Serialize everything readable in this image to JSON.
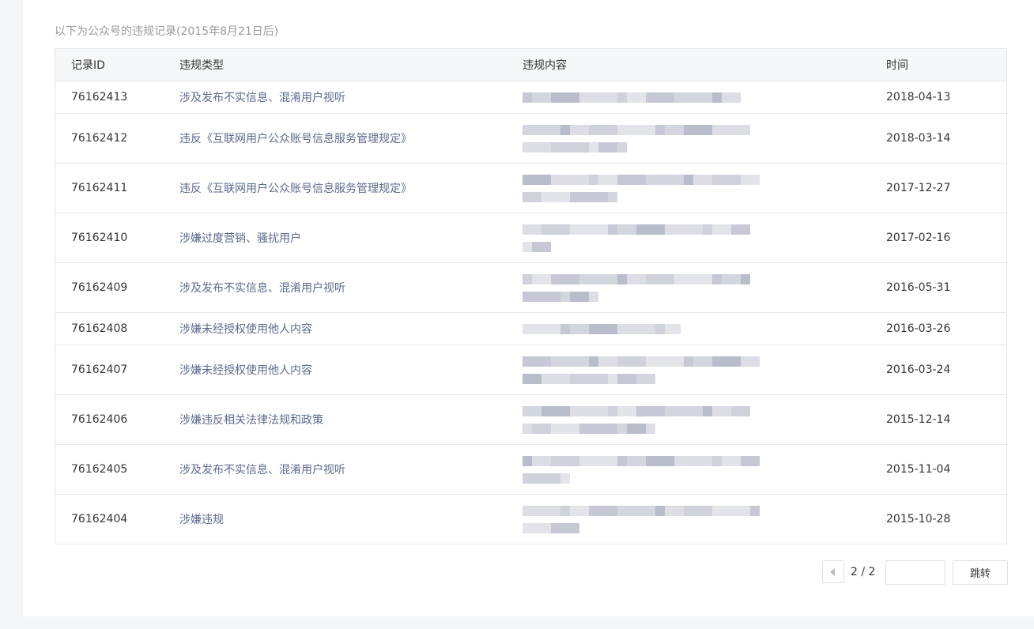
{
  "notice": "以下为公众号的违规记录(2015年8月21日后)",
  "table": {
    "headers": {
      "id": "记录ID",
      "type": "违规类型",
      "content": "违规内容",
      "time": "时间"
    },
    "rows": [
      {
        "id": "76162413",
        "type": "涉及发布不实信息、混淆用户视听",
        "time": "2018-04-13"
      },
      {
        "id": "76162412",
        "type": "违反《互联网用户公众账号信息服务管理规定》",
        "time": "2018-03-14"
      },
      {
        "id": "76162411",
        "type": "违反《互联网用户公众账号信息服务管理规定》",
        "time": "2017-12-27"
      },
      {
        "id": "76162410",
        "type": "涉嫌过度营销、骚扰用户",
        "time": "2017-02-16"
      },
      {
        "id": "76162409",
        "type": "涉及发布不实信息、混淆用户视听",
        "time": "2016-05-31"
      },
      {
        "id": "76162408",
        "type": "涉嫌未经授权使用他人内容",
        "time": "2016-03-26"
      },
      {
        "id": "76162407",
        "type": "涉嫌未经授权使用他人内容",
        "time": "2016-03-24"
      },
      {
        "id": "76162406",
        "type": "涉嫌违反相关法律法规和政策",
        "time": "2015-12-14"
      },
      {
        "id": "76162405",
        "type": "涉及发布不实信息、混淆用户视听",
        "time": "2015-11-04"
      },
      {
        "id": "76162404",
        "type": "涉嫌违规",
        "time": "2015-10-28"
      }
    ]
  },
  "pagination": {
    "prev_icon": "caret-left-icon",
    "page_text": "2 / 2",
    "input_value": "",
    "go_label": "跳转"
  },
  "colors": {
    "type_link": "#5b6a8e",
    "border": "#e6e7eb",
    "header_bg": "#f6f7f9",
    "blur_block": "#c3c5d3"
  }
}
